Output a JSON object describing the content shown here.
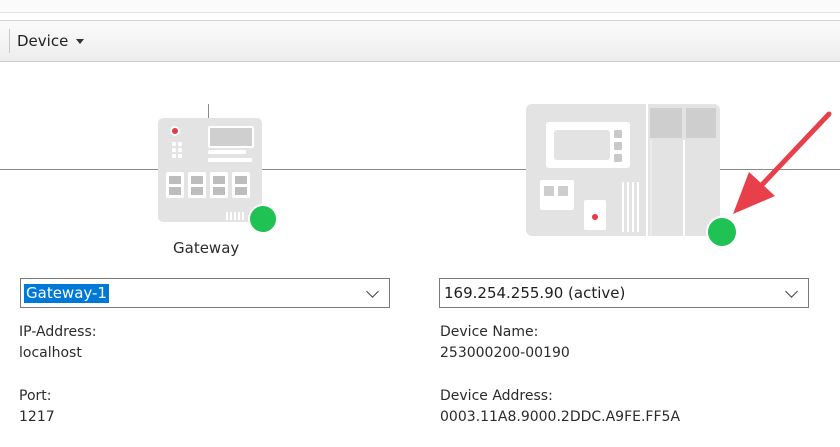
{
  "toolbar": {
    "device_menu": "Device"
  },
  "gateway": {
    "name": "Gateway",
    "selected_value": "Gateway-1",
    "ip_label": "IP-Address:",
    "ip_value": "localhost",
    "port_label": "Port:",
    "port_value": "1217",
    "status_color": "#1fc253"
  },
  "device": {
    "selected_value": "169.254.255.90 (active)",
    "name_label": "Device Name:",
    "name_value": "253000200-00190",
    "address_label": "Device Address:",
    "address_value": "0003.11A8.9000.2DDC.A9FE.FF5A",
    "status_color": "#1fc253"
  },
  "annotation": {
    "arrow_color": "#e8404a"
  }
}
